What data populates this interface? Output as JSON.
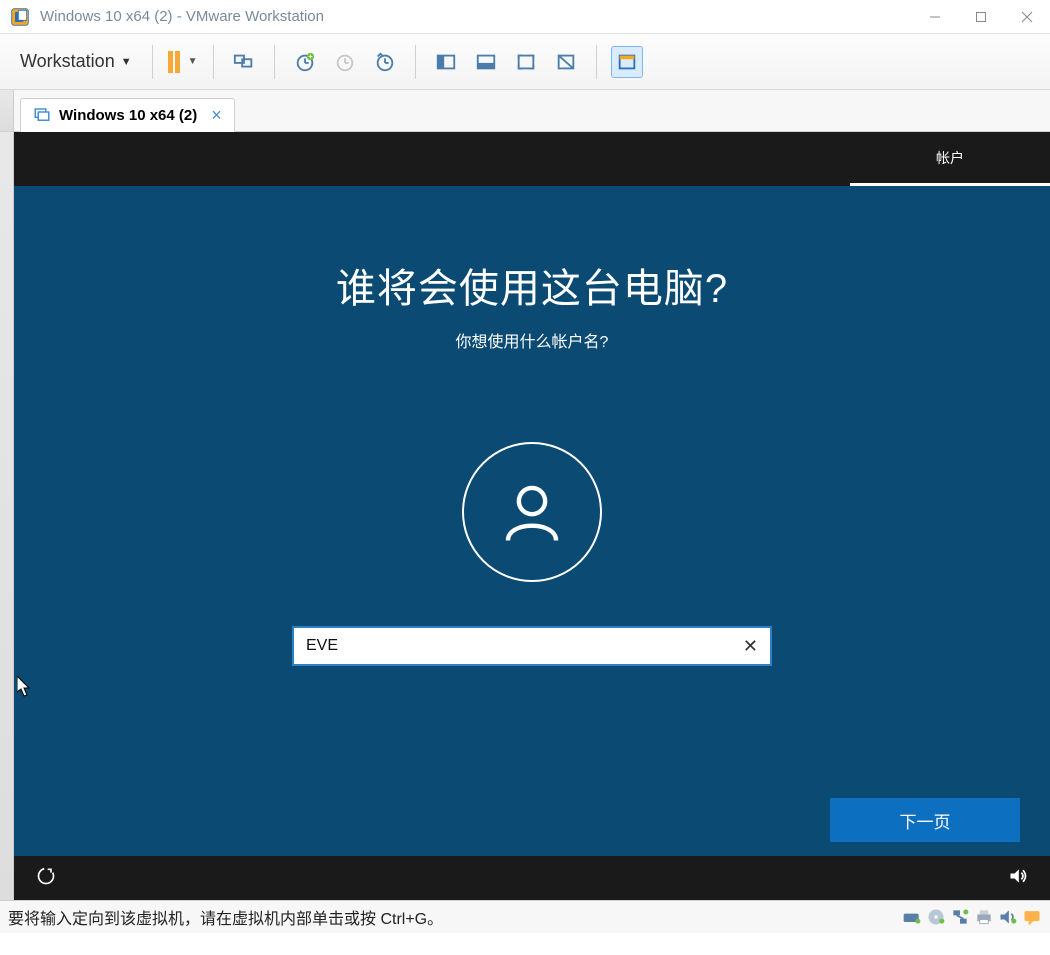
{
  "window": {
    "title": "Windows 10 x64 (2) - VMware Workstation"
  },
  "menu": {
    "label": "Workstation"
  },
  "tab": {
    "label": "Windows 10 x64 (2)"
  },
  "oobe": {
    "tab_label": "帐户",
    "heading": "谁将会使用这台电脑?",
    "subheading": "你想使用什么帐户名?",
    "input_value": "EVE",
    "next_label": "下一页"
  },
  "statusbar": {
    "text": "要将输入定向到该虚拟机，请在虚拟机内部单击或按 Ctrl+G。"
  }
}
